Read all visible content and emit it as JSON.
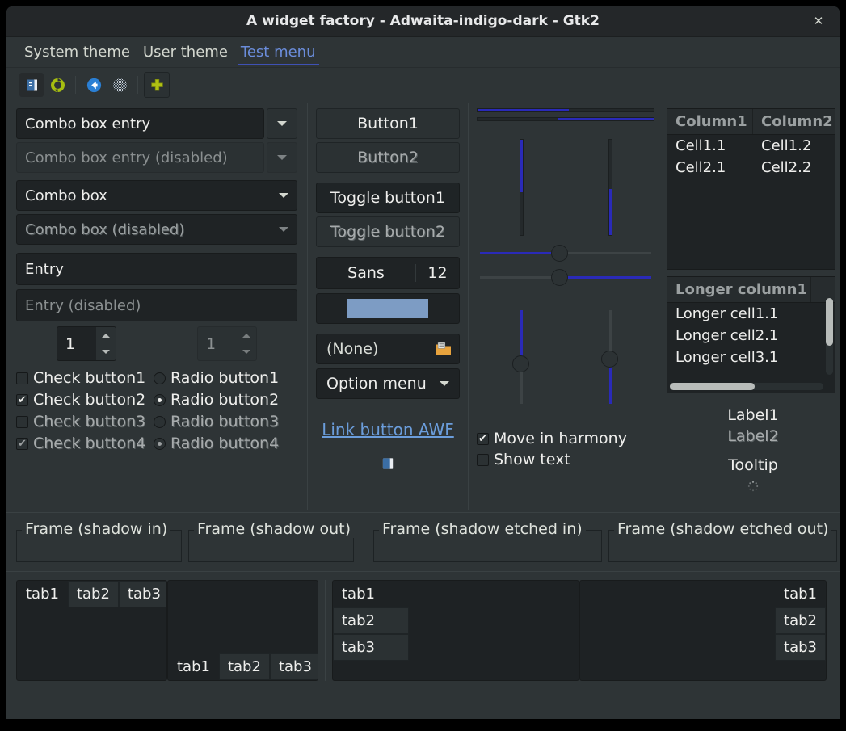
{
  "window": {
    "title": "A widget factory - Adwaita-indigo-dark - Gtk2",
    "close_label": "✕"
  },
  "menubar": {
    "items": [
      {
        "label": "System theme",
        "active": false
      },
      {
        "label": "User theme",
        "active": false
      },
      {
        "label": "Test menu",
        "active": true
      }
    ]
  },
  "toolbar": {
    "buttons": [
      {
        "icon": "document-icon",
        "name": "toolbar-new-button"
      },
      {
        "icon": "refresh-icon",
        "name": "toolbar-refresh-button"
      },
      {
        "icon": "back-arrow-icon",
        "name": "toolbar-back-button"
      },
      {
        "icon": "globe-icon",
        "name": "toolbar-web-button"
      },
      {
        "icon": "plus-icon",
        "name": "toolbar-add-button"
      }
    ]
  },
  "left": {
    "combo_entry": {
      "value": "Combo box entry"
    },
    "combo_entry_disabled": {
      "value": "Combo box entry (disabled)"
    },
    "combo_box": {
      "value": "Combo box"
    },
    "combo_box_disabled": {
      "value": "Combo box (disabled)"
    },
    "entry": {
      "value": "Entry"
    },
    "entry_disabled": {
      "value": "Entry (disabled)"
    },
    "spin": {
      "value": "1"
    },
    "spin_disabled": {
      "value": "1"
    },
    "checks": [
      {
        "label": "Check button1",
        "checked": false,
        "disabled": false
      },
      {
        "label": "Check button2",
        "checked": true,
        "disabled": false
      },
      {
        "label": "Check button3",
        "checked": false,
        "disabled": true
      },
      {
        "label": "Check button4",
        "checked": true,
        "disabled": true
      }
    ],
    "radios": [
      {
        "label": "Radio button1",
        "selected": false,
        "disabled": false
      },
      {
        "label": "Radio button2",
        "selected": true,
        "disabled": false
      },
      {
        "label": "Radio button3",
        "selected": false,
        "disabled": true
      },
      {
        "label": "Radio button4",
        "selected": true,
        "disabled": true
      }
    ]
  },
  "mid": {
    "button1": "Button1",
    "button2": "Button2",
    "toggle1": "Toggle button1",
    "toggle2": "Toggle button2",
    "font_name": "Sans",
    "font_size": "12",
    "color_value": "#7d9cc4",
    "file_label": "(None)",
    "option_menu": "Option menu",
    "link": "Link button AWF"
  },
  "scales": {
    "progress_top_percent": 52,
    "progress_bottom_percent": 54,
    "vprogress_left_percent": 55,
    "vprogress_right_percent": 48,
    "hscale_top_percent": 46,
    "hscale_bottom_percent": 46,
    "vscale_left_percent": 57,
    "vscale_right_percent": 52,
    "checks": [
      {
        "label": "Move in harmony",
        "checked": true
      },
      {
        "label": "Show text",
        "checked": false
      }
    ]
  },
  "tree_top": {
    "columns": [
      "Column1",
      "Column2"
    ],
    "rows": [
      [
        "Cell1.1",
        "Cell1.2"
      ],
      [
        "Cell2.1",
        "Cell2.2"
      ]
    ]
  },
  "tree_bottom": {
    "columns": [
      "Longer column1"
    ],
    "rows": [
      [
        "Longer cell1.1"
      ],
      [
        "Longer cell2.1"
      ],
      [
        "Longer cell3.1"
      ]
    ]
  },
  "right_labels": {
    "label1": "Label1",
    "label2": "Label2",
    "tooltip": "Tooltip"
  },
  "frames": [
    {
      "label": "Frame (shadow in)"
    },
    {
      "label": "Frame (shadow out)"
    },
    {
      "label": "Frame (shadow etched in)"
    },
    {
      "label": "Frame (shadow etched out)"
    }
  ],
  "notebooks": [
    {
      "position": "top",
      "tabs": [
        "tab1",
        "tab2",
        "tab3"
      ],
      "selected": 0
    },
    {
      "position": "bottom",
      "tabs": [
        "tab1",
        "tab2",
        "tab3"
      ],
      "selected": 0
    },
    {
      "position": "left",
      "tabs": [
        "tab1",
        "tab2",
        "tab3"
      ],
      "selected": 0
    },
    {
      "position": "right",
      "tabs": [
        "tab1",
        "tab2",
        "tab3"
      ],
      "selected": 0
    }
  ],
  "colors": {
    "window_bg": "#2e3436",
    "titlebar_bg": "#242729",
    "entry_bg": "#1f2325",
    "accent_link": "#6b9ddb",
    "accent_menu": "#6b8ddb",
    "progress_fill": "#2a2ab8",
    "underline": "#3f51b5"
  }
}
